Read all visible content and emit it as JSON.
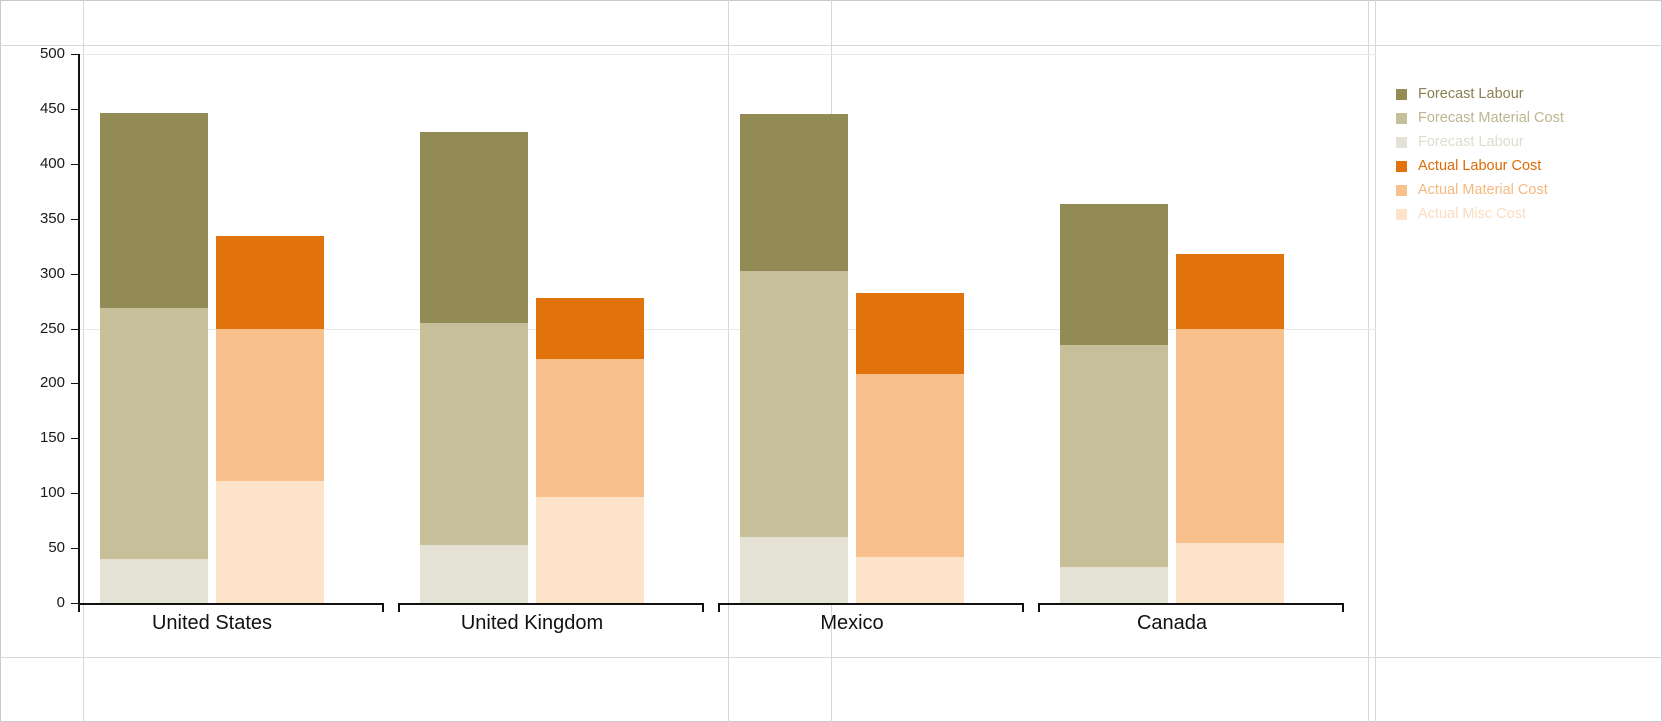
{
  "chart_data": {
    "type": "bar",
    "subtype": "grouped-stacked",
    "title": "",
    "subtitle": "",
    "xlabel": "",
    "ylabel": "",
    "categories": [
      "United States",
      "United Kingdom",
      "Mexico",
      "Canada"
    ],
    "ylim": [
      0,
      500
    ],
    "ytick_values": [
      0,
      50,
      100,
      150,
      200,
      250,
      300,
      350,
      400,
      450,
      500
    ],
    "ytick_labels": [
      "0",
      "50",
      "100",
      "150",
      "200",
      "250",
      "300",
      "350",
      "400",
      "450",
      "500"
    ],
    "grid": true,
    "grid_axis": "y",
    "legend_position": "right",
    "groups": [
      {
        "name": "Forecast",
        "series": [
          {
            "name": "Forecast Labour",
            "color": "#938B55",
            "values": [
              177,
              174,
              143,
              128
            ]
          },
          {
            "name": "Forecast Material Cost",
            "color": "#C6BF9A",
            "values": [
              229,
              202,
              242,
              202
            ]
          },
          {
            "name": "Forecast Labour",
            "color": "#E4E2D5",
            "values": [
              40,
              53,
              60,
              33
            ]
          }
        ],
        "totals": [
          446,
          429,
          445,
          363
        ]
      },
      {
        "name": "Actual",
        "series": [
          {
            "name": "Actual Labour Cost",
            "color": "#E2720C",
            "values": [
              84,
              56,
              73,
              68
            ]
          },
          {
            "name": "Actual Material Cost",
            "color": "#F7C08C",
            "values": [
              139,
              125,
              167,
              195
            ]
          },
          {
            "name": "Actual Misc Cost",
            "color": "#FDE3CA",
            "values": [
              111,
              97,
              42,
              55
            ]
          }
        ],
        "totals": [
          334,
          278,
          282,
          318
        ]
      }
    ],
    "series_flat": [
      {
        "name": "Forecast Labour",
        "color": "#938B55",
        "values": [
          177,
          174,
          143,
          128
        ],
        "stack": "forecast"
      },
      {
        "name": "Forecast Material Cost",
        "color": "#C6BF9A",
        "values": [
          229,
          202,
          242,
          202
        ],
        "stack": "forecast"
      },
      {
        "name": "Forecast Labour",
        "color": "#E4E2D5",
        "values": [
          40,
          53,
          60,
          33
        ],
        "stack": "forecast"
      },
      {
        "name": "Actual Labour Cost",
        "color": "#E2720C",
        "values": [
          84,
          56,
          73,
          68
        ],
        "stack": "actual"
      },
      {
        "name": "Actual Material Cost",
        "color": "#F7C08C",
        "values": [
          139,
          125,
          167,
          195
        ],
        "stack": "actual"
      },
      {
        "name": "Actual Misc Cost",
        "color": "#FDE3CA",
        "values": [
          111,
          97,
          42,
          55
        ],
        "stack": "actual"
      }
    ]
  },
  "legend": {
    "items": [
      {
        "label": "Forecast Labour",
        "color": "#938B55",
        "text_color": "#8a8150"
      },
      {
        "label": "Forecast Material Cost",
        "color": "#C6BF9A",
        "text_color": "#bdb58f"
      },
      {
        "label": "Forecast Labour",
        "color": "#E4E2D5",
        "text_color": "#dedccd"
      },
      {
        "label": "Actual Labour Cost",
        "color": "#E2720C",
        "text_color": "#dd6c07"
      },
      {
        "label": "Actual Material Cost",
        "color": "#F7C08C",
        "text_color": "#f5b87f"
      },
      {
        "label": "Actual Misc Cost",
        "color": "#FDE3CA",
        "text_color": "#fbdcc0"
      }
    ]
  },
  "axis": {
    "y_labels": [
      "500",
      "450",
      "400",
      "350",
      "300",
      "250",
      "200",
      "150",
      "100",
      "50",
      "0"
    ],
    "x_labels": [
      "United States",
      "United Kingdom",
      "Mexico",
      "Canada"
    ]
  }
}
